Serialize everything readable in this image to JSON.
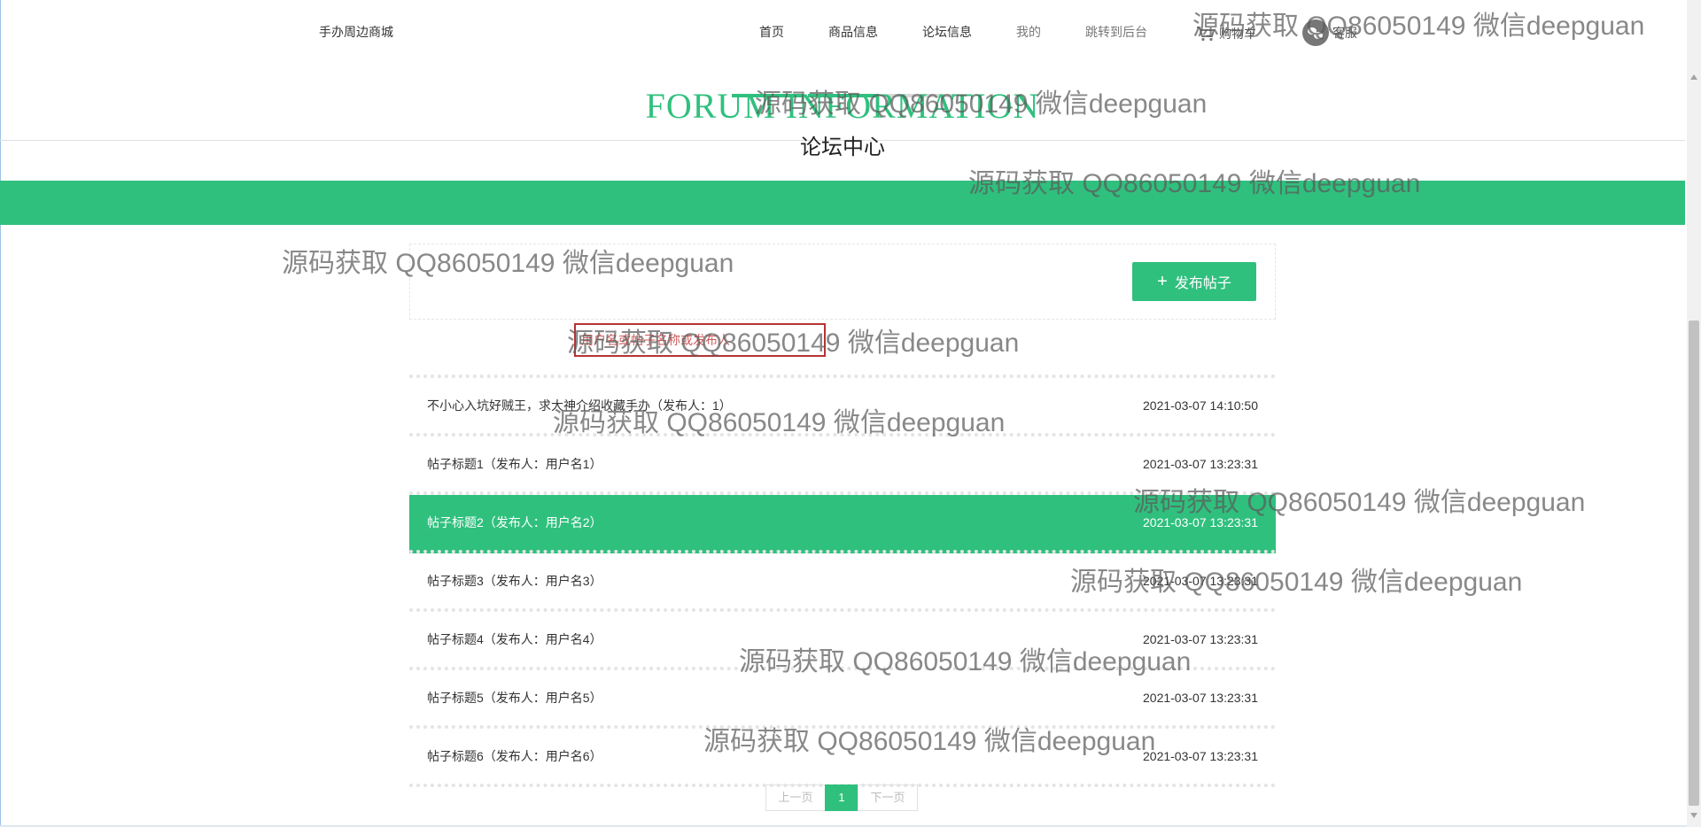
{
  "header": {
    "brand": "手办周边商城",
    "nav": [
      "首页",
      "商品信息",
      "论坛信息",
      "我的",
      "跳转到后台"
    ],
    "cart": "购物车",
    "service": "客服"
  },
  "page": {
    "title_en": "FORUM INFORMATION",
    "title_cn": "论坛中心",
    "publish_button": "发布帖子"
  },
  "search": {
    "value": "",
    "placeholder": "用户名或帖子名称或发布人"
  },
  "posts": [
    {
      "title": "不小心入坑好贼王，求大神介绍收藏手办（发布人：1）",
      "time": "2021-03-07 14:10:50"
    },
    {
      "title": "帖子标题1（发布人：用户名1）",
      "time": "2021-03-07 13:23:31"
    },
    {
      "title": "帖子标题2（发布人：用户名2）",
      "time": "2021-03-07 13:23:31"
    },
    {
      "title": "帖子标题3（发布人：用户名3）",
      "time": "2021-03-07 13:23:31"
    },
    {
      "title": "帖子标题4（发布人：用户名4）",
      "time": "2021-03-07 13:23:31"
    },
    {
      "title": "帖子标题5（发布人：用户名5）",
      "time": "2021-03-07 13:23:31"
    },
    {
      "title": "帖子标题6（发布人：用户名6）",
      "time": "2021-03-07 13:23:31"
    }
  ],
  "pagination": {
    "prev": "上一页",
    "current": "1",
    "next": "下一页"
  },
  "watermark": "源码获取 QQ86050149 微信deepguan",
  "colors": {
    "accent": "#30c07e",
    "highlight_border": "#b53434"
  }
}
